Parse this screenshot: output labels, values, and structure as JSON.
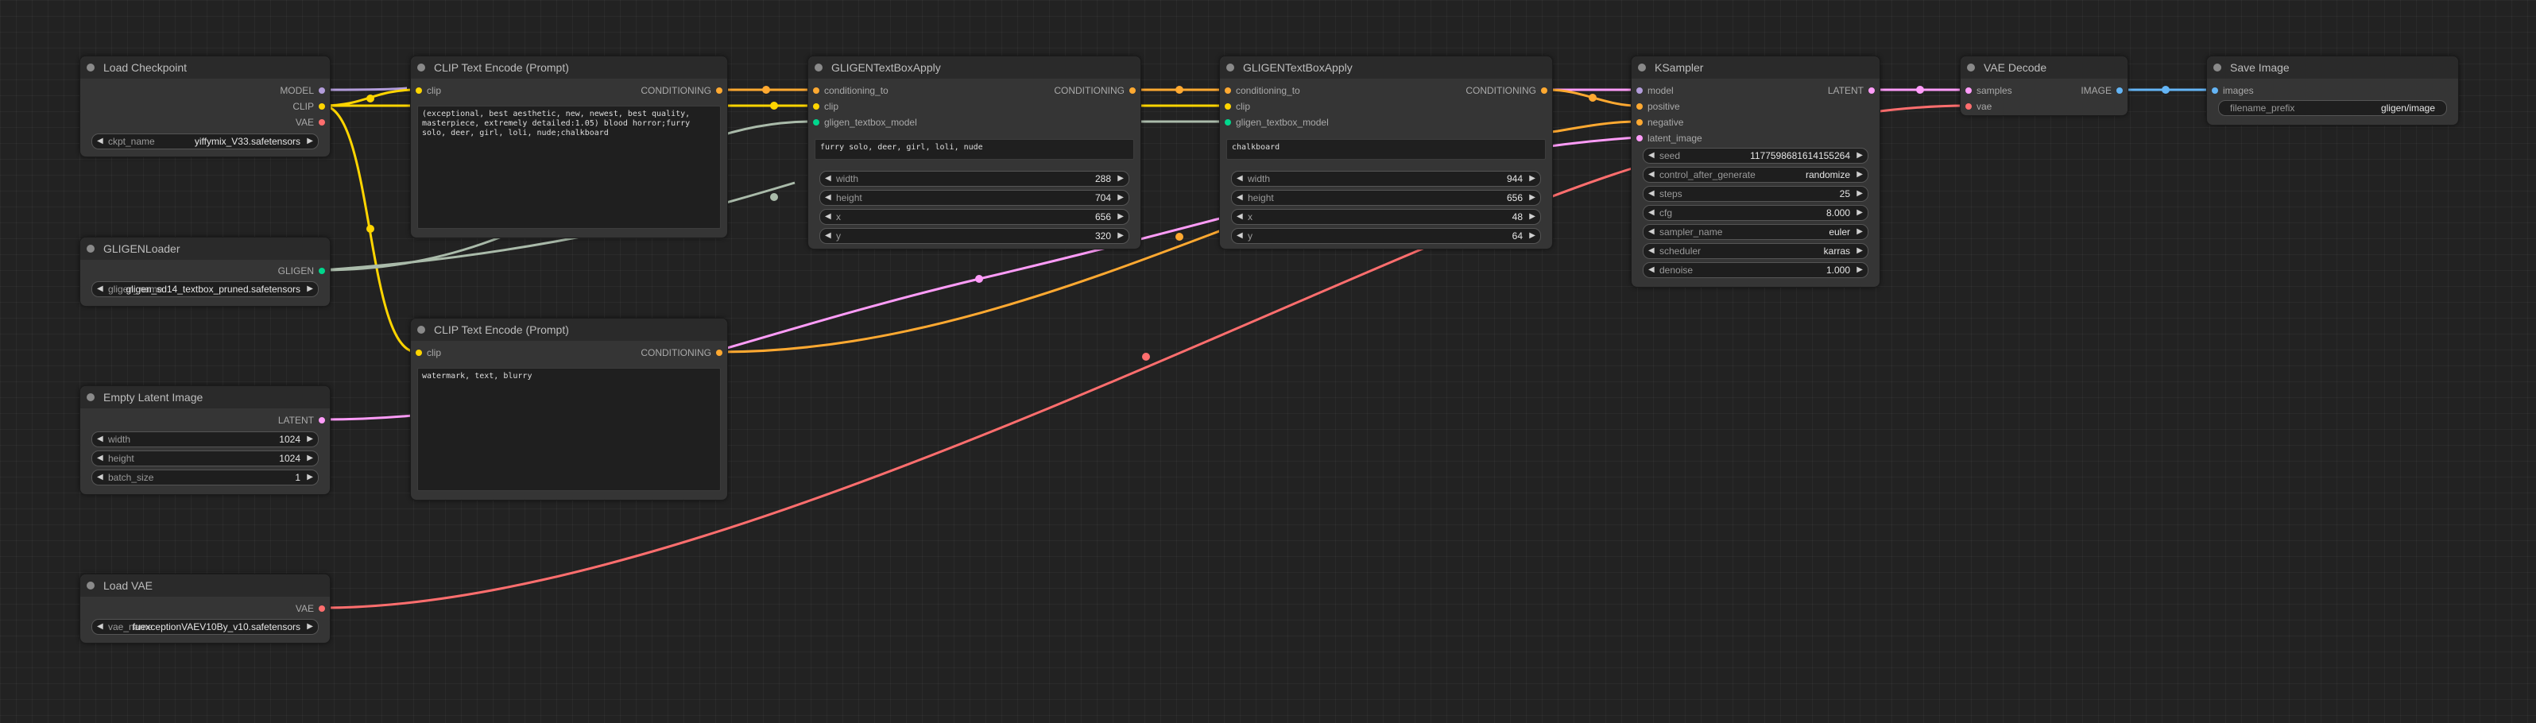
{
  "colors": {
    "background": "#222222",
    "model": "#b39ddb",
    "clip": "#ffd500",
    "vae": "#ff6e6e",
    "conditioning": "#ffa931",
    "latent": "#ff9cf9",
    "image": "#64b5f6",
    "gligen": "#aabbaa"
  },
  "nodes": {
    "load_checkpoint": {
      "title": "Load Checkpoint",
      "outputs": [
        "MODEL",
        "CLIP",
        "VAE"
      ],
      "widget": {
        "label": "ckpt_name",
        "value": "yiffymix_V33.safetensors"
      }
    },
    "gligen_loader": {
      "title": "GLIGENLoader",
      "outputs": [
        "GLIGEN"
      ],
      "widget": {
        "label": "gligen_name",
        "value": "gligen_sd14_textbox_pruned.safetensors"
      }
    },
    "empty_latent": {
      "title": "Empty Latent Image",
      "outputs": [
        "LATENT"
      ],
      "widgets": [
        {
          "label": "width",
          "value": "1024"
        },
        {
          "label": "height",
          "value": "1024"
        },
        {
          "label": "batch_size",
          "value": "1"
        }
      ]
    },
    "load_vae": {
      "title": "Load VAE",
      "outputs": [
        "VAE"
      ],
      "widget": {
        "label": "vae_name",
        "value": "fuexceptionVAEV10By_v10.safetensors"
      }
    },
    "clip_pos": {
      "title": "CLIP Text Encode (Prompt)",
      "inputs": [
        "clip"
      ],
      "outputs": [
        "CONDITIONING"
      ],
      "text": "(exceptional, best aesthetic, new, newest, best quality, masterpiece, extremely detailed:1.05) blood horror;furry solo, deer, girl, loli, nude;chalkboard"
    },
    "clip_neg": {
      "title": "CLIP Text Encode (Prompt)",
      "inputs": [
        "clip"
      ],
      "outputs": [
        "CONDITIONING"
      ],
      "text": "watermark, text, blurry"
    },
    "gligen1": {
      "title": "GLIGENTextBoxApply",
      "inputs": [
        "conditioning_to",
        "clip",
        "gligen_textbox_model"
      ],
      "outputs": [
        "CONDITIONING"
      ],
      "text": "furry solo, deer, girl, loli, nude",
      "widgets": [
        {
          "label": "width",
          "value": "288"
        },
        {
          "label": "height",
          "value": "704"
        },
        {
          "label": "x",
          "value": "656"
        },
        {
          "label": "y",
          "value": "320"
        }
      ]
    },
    "gligen2": {
      "title": "GLIGENTextBoxApply",
      "inputs": [
        "conditioning_to",
        "clip",
        "gligen_textbox_model"
      ],
      "outputs": [
        "CONDITIONING"
      ],
      "text": "chalkboard",
      "widgets": [
        {
          "label": "width",
          "value": "944"
        },
        {
          "label": "height",
          "value": "656"
        },
        {
          "label": "x",
          "value": "48"
        },
        {
          "label": "y",
          "value": "64"
        }
      ]
    },
    "ksampler": {
      "title": "KSampler",
      "inputs": [
        "model",
        "positive",
        "negative",
        "latent_image"
      ],
      "outputs": [
        "LATENT"
      ],
      "widgets": [
        {
          "label": "seed",
          "value": "1177598681614155264"
        },
        {
          "label": "control_after_generate",
          "value": "randomize"
        },
        {
          "label": "steps",
          "value": "25"
        },
        {
          "label": "cfg",
          "value": "8.000"
        },
        {
          "label": "sampler_name",
          "value": "euler"
        },
        {
          "label": "scheduler",
          "value": "karras"
        },
        {
          "label": "denoise",
          "value": "1.000"
        }
      ]
    },
    "vae_decode": {
      "title": "VAE Decode",
      "inputs": [
        "samples",
        "vae"
      ],
      "outputs": [
        "IMAGE"
      ]
    },
    "save_image": {
      "title": "Save Image",
      "inputs": [
        "images"
      ],
      "widget": {
        "label": "filename_prefix",
        "value": "gligen/image"
      }
    }
  }
}
